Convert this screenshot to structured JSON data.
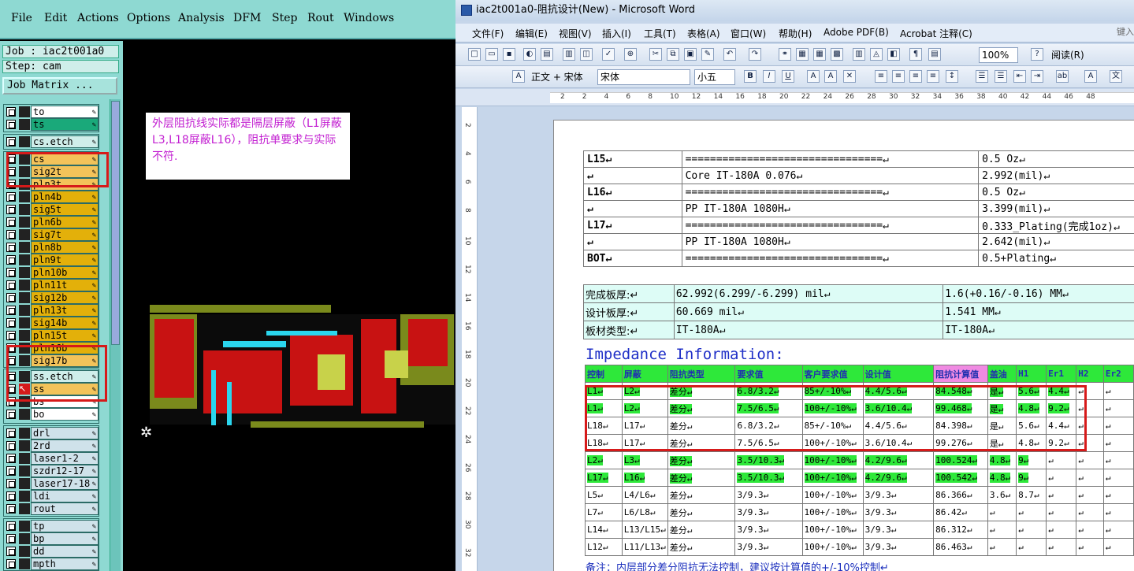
{
  "cam": {
    "menu": [
      "File",
      "Edit",
      "Actions",
      "Options",
      "Analysis",
      "DFM",
      "Step",
      "Rout",
      "Windows"
    ],
    "job_label": "Job : iac2t001a0",
    "step_label": "Step: cam",
    "job_matrix": "Job Matrix ...",
    "layers_group1": [
      {
        "name": "to",
        "color": "#ffffff"
      },
      {
        "name": "ts",
        "color": "#1aa97a"
      }
    ],
    "layers_group2": [
      {
        "name": "cs.etch",
        "color": "#cfeeea"
      }
    ],
    "layers_group3": [
      {
        "name": "cs",
        "color": "#f3c35a"
      },
      {
        "name": "sig2t",
        "color": "#f3c35a"
      },
      {
        "name": "pln3t",
        "color": "#f3c35a"
      },
      {
        "name": "pln4b",
        "color": "#e3b00a"
      },
      {
        "name": "sig5t",
        "color": "#e3b00a"
      },
      {
        "name": "pln6b",
        "color": "#e3b00a"
      },
      {
        "name": "sig7t",
        "color": "#e3b00a"
      },
      {
        "name": "pln8b",
        "color": "#e3b00a"
      },
      {
        "name": "pln9t",
        "color": "#e3b00a"
      },
      {
        "name": "pln10b",
        "color": "#e3b00a"
      },
      {
        "name": "pln11t",
        "color": "#e3b00a"
      },
      {
        "name": "sig12b",
        "color": "#e3b00a"
      },
      {
        "name": "pln13t",
        "color": "#e3b00a"
      },
      {
        "name": "sig14b",
        "color": "#e3b00a"
      },
      {
        "name": "pln15t",
        "color": "#e3b00a"
      },
      {
        "name": "pln16b",
        "color": "#e3b00a"
      },
      {
        "name": "sig17b",
        "color": "#f3c35a"
      }
    ],
    "layers_group4": [
      {
        "name": "ss.etch",
        "color": "#cfeeea"
      },
      {
        "name": "ss",
        "color": "#f3c35a"
      },
      {
        "name": "bs",
        "color": "#ffffff"
      },
      {
        "name": "bo",
        "color": "#ffffff"
      }
    ],
    "layers_group5": [
      {
        "name": "drl",
        "color": "#cfe2ea"
      },
      {
        "name": "2rd",
        "color": "#cfe2ea"
      },
      {
        "name": "laser1-2",
        "color": "#cfe2ea"
      },
      {
        "name": "szdr12-17",
        "color": "#cfe2ea"
      },
      {
        "name": "laser17-18",
        "color": "#cfe2ea"
      },
      {
        "name": "ldi",
        "color": "#cfe2ea"
      },
      {
        "name": "rout",
        "color": "#cfe2ea"
      }
    ],
    "layers_group6": [
      {
        "name": "tp",
        "color": "#cfe2ea"
      },
      {
        "name": "bp",
        "color": "#cfe2ea"
      },
      {
        "name": "dd",
        "color": "#cfe2ea"
      },
      {
        "name": "mpth",
        "color": "#cfe2ea"
      }
    ],
    "note": "外层阻抗线实际都是隔层屏蔽（L1屏蔽L3,L18屏蔽L16），阻抗单要求与实际不符."
  },
  "word": {
    "title": "iac2t001a0-阻抗设计(New) - Microsoft Word",
    "menu": [
      "文件(F)",
      "编辑(E)",
      "视图(V)",
      "插入(I)",
      "工具(T)",
      "表格(A)",
      "窗口(W)",
      "帮助(H)",
      "Adobe PDF(B)",
      "Acrobat 注释(C)"
    ],
    "search_hint": "键入",
    "zoom": "100%",
    "read_mode": "阅读(R)",
    "style": "正文 + 宋体",
    "font": "宋体",
    "size": "小五",
    "ruler_ticks": [
      "2",
      "2",
      "4",
      "6",
      "8",
      "10",
      "12",
      "14",
      "16",
      "18",
      "20",
      "22",
      "24",
      "26",
      "28",
      "30",
      "32",
      "34",
      "36",
      "38",
      "40",
      "42",
      "44",
      "46",
      "48"
    ],
    "vruler_ticks": [
      "2",
      "4",
      "6",
      "8",
      "10",
      "12",
      "14",
      "16",
      "18",
      "20",
      "22",
      "24",
      "26",
      "28",
      "30",
      "32"
    ],
    "stack": [
      [
        "L15↵",
        "================================↵",
        "0.5 Oz↵"
      ],
      [
        "↵",
        "Core     IT-180A    0.076↵",
        "2.992(mil)↵"
      ],
      [
        "L16↵",
        "================================↵",
        "0.5 Oz↵"
      ],
      [
        "↵",
        "PP     IT-180A     1080H↵",
        "3.399(mil)↵"
      ],
      [
        "L17↵",
        "================================↵",
        "0.333_Plating(完成1oz)↵"
      ],
      [
        "↵",
        "PP     IT-180A     1080H↵",
        "2.642(mil)↵"
      ],
      [
        "BOT↵",
        "================================↵",
        "0.5+Plating↵"
      ]
    ],
    "thickness": [
      [
        "完成板厚:↵",
        "62.992(6.299/-6.299) mil↵",
        "1.6(+0.16/-0.16) MM↵"
      ],
      [
        "设计板厚:↵",
        "60.669 mil↵",
        "1.541 MM↵"
      ],
      [
        "板材类型:↵",
        "IT-180A↵",
        "IT-180A↵"
      ]
    ],
    "impedance_title": "Impedance Information:",
    "imp_headers": [
      "控制",
      "屏蔽",
      "阻抗类型",
      "要求值",
      "客户要求值",
      "设计值",
      "阻抗计算值",
      "盖油",
      "H1",
      "Er1",
      "H2",
      "Er2"
    ],
    "imp_rows": [
      {
        "cells": [
          "L1↵",
          "L2↵",
          "差分↵",
          "6.8/3.2↵",
          "85+/-10%↵",
          "4.4/5.6↵",
          "84.548↵",
          "是↵",
          "5.6↵",
          "4.4↵",
          "↵",
          "↵"
        ],
        "hl": [
          0,
          1,
          2,
          3,
          4,
          5,
          6,
          7,
          8,
          9
        ]
      },
      {
        "cells": [
          "L1↵",
          "L2↵",
          "差分↵",
          "7.5/6.5↵",
          "100+/-10%↵",
          "3.6/10.4↵",
          "99.468↵",
          "是↵",
          "4.8↵",
          "9.2↵",
          "↵",
          "↵"
        ],
        "hl": [
          0,
          1,
          2,
          3,
          4,
          5,
          6,
          7,
          8,
          9
        ]
      },
      {
        "cells": [
          "L18↵",
          "L17↵",
          "差分↵",
          "6.8/3.2↵",
          "85+/-10%↵",
          "4.4/5.6↵",
          "84.398↵",
          "是↵",
          "5.6↵",
          "4.4↵",
          "↵",
          "↵"
        ],
        "hl": []
      },
      {
        "cells": [
          "L18↵",
          "L17↵",
          "差分↵",
          "7.5/6.5↵",
          "100+/-10%↵",
          "3.6/10.4↵",
          "99.276↵",
          "是↵",
          "4.8↵",
          "9.2↵",
          "↵",
          "↵"
        ],
        "hl": []
      },
      {
        "cells": [
          "L2↵",
          "L3↵",
          "差分↵",
          "3.5/10.3↵",
          "100+/-10%↵",
          "4.2/9.6↵",
          "100.524↵",
          "4.8↵",
          "9↵",
          "↵",
          "↵",
          "↵"
        ],
        "hl": [
          0,
          1,
          2,
          3,
          4,
          5,
          6,
          7,
          8
        ]
      },
      {
        "cells": [
          "L17↵",
          "L16↵",
          "差分↵",
          "3.5/10.3↵",
          "100+/-10%↵",
          "4.2/9.6↵",
          "100.542↵",
          "4.8↵",
          "9↵",
          "↵",
          "↵",
          "↵"
        ],
        "hl": [
          0,
          1,
          2,
          3,
          4,
          5,
          6,
          7,
          8
        ]
      },
      {
        "cells": [
          "L5↵",
          "L4/L6↵",
          "差分↵",
          "3/9.3↵",
          "100+/-10%↵",
          "3/9.3↵",
          "86.366↵",
          "3.6↵",
          "8.7↵",
          "↵",
          "↵",
          "↵"
        ],
        "hl": []
      },
      {
        "cells": [
          "L7↵",
          "L6/L8↵",
          "差分↵",
          "3/9.3↵",
          "100+/-10%↵",
          "3/9.3↵",
          "86.42↵",
          "↵",
          "↵",
          "↵",
          "↵",
          "↵"
        ],
        "hl": []
      },
      {
        "cells": [
          "L14↵",
          "L13/L15↵",
          "差分↵",
          "3/9.3↵",
          "100+/-10%↵",
          "3/9.3↵",
          "86.312↵",
          "↵",
          "↵",
          "↵",
          "↵",
          "↵"
        ],
        "hl": []
      },
      {
        "cells": [
          "L12↵",
          "L11/L13↵",
          "差分↵",
          "3/9.3↵",
          "100+/-10%↵",
          "3/9.3↵",
          "86.463↵",
          "↵",
          "↵",
          "↵",
          "↵",
          "↵"
        ],
        "hl": []
      }
    ],
    "footnote": "备注：内层部分差分阻抗无法控制，建议按计算值的+/-10%控制↵"
  }
}
